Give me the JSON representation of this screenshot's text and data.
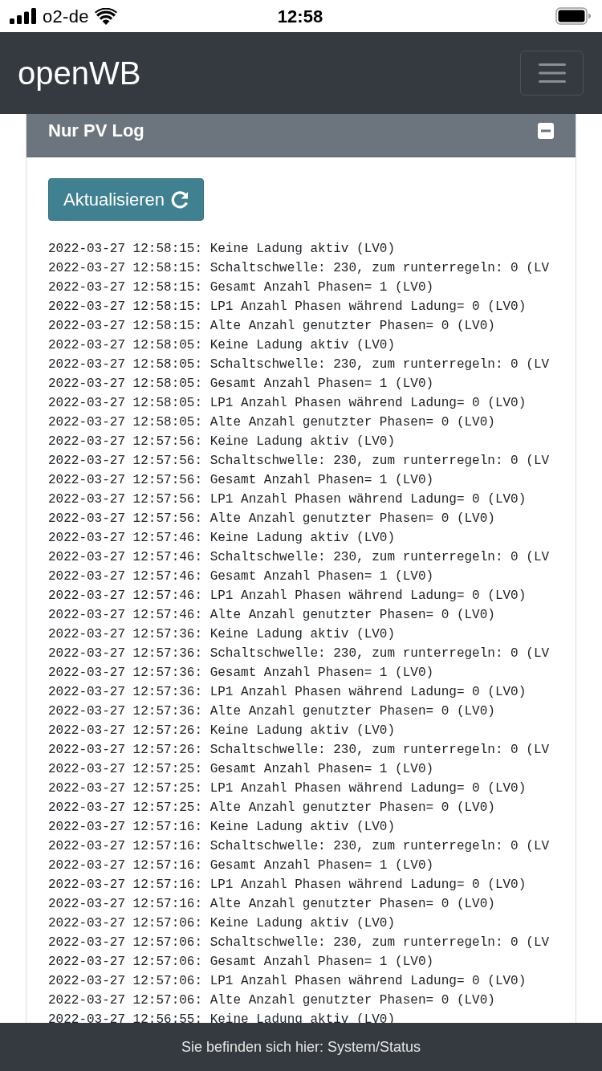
{
  "status_bar": {
    "carrier": "o2-de",
    "time": "12:58"
  },
  "navbar": {
    "brand": "openWB"
  },
  "card": {
    "title": "Nur PV Log",
    "expanded": true,
    "refresh_button": "Aktualisieren",
    "log_lines": [
      "2022-03-27 12:58:15: Keine Ladung aktiv (LV0)",
      "2022-03-27 12:58:15: Schaltschwelle: 230, zum runterregeln: 0 (LV",
      "2022-03-27 12:58:15: Gesamt Anzahl Phasen= 1 (LV0)",
      "2022-03-27 12:58:15: LP1 Anzahl Phasen während Ladung= 0 (LV0)",
      "2022-03-27 12:58:15: Alte Anzahl genutzter Phasen= 0 (LV0)",
      "2022-03-27 12:58:05: Keine Ladung aktiv (LV0)",
      "2022-03-27 12:58:05: Schaltschwelle: 230, zum runterregeln: 0 (LV",
      "2022-03-27 12:58:05: Gesamt Anzahl Phasen= 1 (LV0)",
      "2022-03-27 12:58:05: LP1 Anzahl Phasen während Ladung= 0 (LV0)",
      "2022-03-27 12:58:05: Alte Anzahl genutzter Phasen= 0 (LV0)",
      "2022-03-27 12:57:56: Keine Ladung aktiv (LV0)",
      "2022-03-27 12:57:56: Schaltschwelle: 230, zum runterregeln: 0 (LV",
      "2022-03-27 12:57:56: Gesamt Anzahl Phasen= 1 (LV0)",
      "2022-03-27 12:57:56: LP1 Anzahl Phasen während Ladung= 0 (LV0)",
      "2022-03-27 12:57:56: Alte Anzahl genutzter Phasen= 0 (LV0)",
      "2022-03-27 12:57:46: Keine Ladung aktiv (LV0)",
      "2022-03-27 12:57:46: Schaltschwelle: 230, zum runterregeln: 0 (LV",
      "2022-03-27 12:57:46: Gesamt Anzahl Phasen= 1 (LV0)",
      "2022-03-27 12:57:46: LP1 Anzahl Phasen während Ladung= 0 (LV0)",
      "2022-03-27 12:57:46: Alte Anzahl genutzter Phasen= 0 (LV0)",
      "2022-03-27 12:57:36: Keine Ladung aktiv (LV0)",
      "2022-03-27 12:57:36: Schaltschwelle: 230, zum runterregeln: 0 (LV",
      "2022-03-27 12:57:36: Gesamt Anzahl Phasen= 1 (LV0)",
      "2022-03-27 12:57:36: LP1 Anzahl Phasen während Ladung= 0 (LV0)",
      "2022-03-27 12:57:36: Alte Anzahl genutzter Phasen= 0 (LV0)",
      "2022-03-27 12:57:26: Keine Ladung aktiv (LV0)",
      "2022-03-27 12:57:26: Schaltschwelle: 230, zum runterregeln: 0 (LV",
      "2022-03-27 12:57:25: Gesamt Anzahl Phasen= 1 (LV0)",
      "2022-03-27 12:57:25: LP1 Anzahl Phasen während Ladung= 0 (LV0)",
      "2022-03-27 12:57:25: Alte Anzahl genutzter Phasen= 0 (LV0)",
      "2022-03-27 12:57:16: Keine Ladung aktiv (LV0)",
      "2022-03-27 12:57:16: Schaltschwelle: 230, zum runterregeln: 0 (LV",
      "2022-03-27 12:57:16: Gesamt Anzahl Phasen= 1 (LV0)",
      "2022-03-27 12:57:16: LP1 Anzahl Phasen während Ladung= 0 (LV0)",
      "2022-03-27 12:57:16: Alte Anzahl genutzter Phasen= 0 (LV0)",
      "2022-03-27 12:57:06: Keine Ladung aktiv (LV0)",
      "2022-03-27 12:57:06: Schaltschwelle: 230, zum runterregeln: 0 (LV",
      "2022-03-27 12:57:06: Gesamt Anzahl Phasen= 1 (LV0)",
      "2022-03-27 12:57:06: LP1 Anzahl Phasen während Ladung= 0 (LV0)",
      "2022-03-27 12:57:06: Alte Anzahl genutzter Phasen= 0 (LV0)",
      "2022-03-27 12:56:55: Keine Ladung aktiv (LV0)"
    ]
  },
  "footer": {
    "text": "Sie befinden sich hier: System/Status"
  }
}
